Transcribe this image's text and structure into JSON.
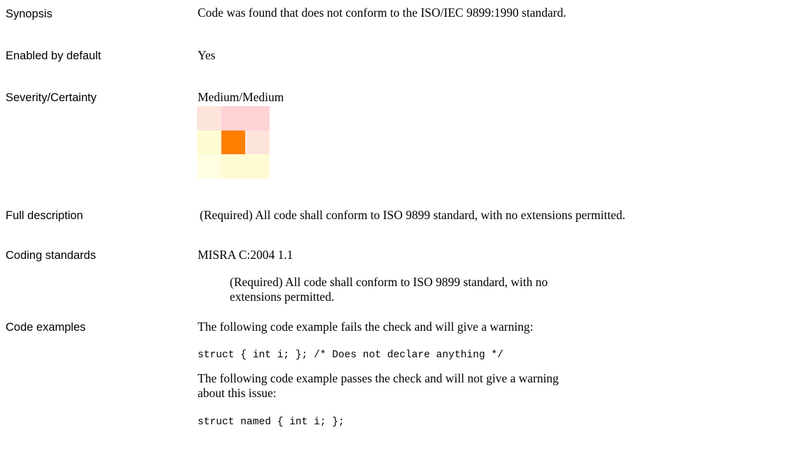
{
  "rows": {
    "synopsis": {
      "label": "Synopsis",
      "value": "Code was found that does not conform to the ISO/IEC 9899:1990 standard."
    },
    "enabled": {
      "label": "Enabled by default",
      "value": "Yes"
    },
    "severity": {
      "label": "Severity/Certainty",
      "value": "Medium/Medium",
      "matrix_colors": [
        [
          "#fde4da",
          "#fdd3d6",
          "#fdd3d6"
        ],
        [
          "#fffbd3",
          "#ff7f00",
          "#fde4da"
        ],
        [
          "#fffde2",
          "#fffbd3",
          "#fffbd3"
        ]
      ]
    },
    "full_description": {
      "label": "Full description",
      "value": "(Required) All code shall conform to ISO 9899 standard, with no extensions permitted."
    },
    "coding_standards": {
      "label": "Coding standards",
      "standard": "MISRA C:2004 1.1",
      "detail": "(Required) All code shall conform to ISO 9899 standard, with no extensions permitted."
    },
    "code_examples": {
      "label": "Code examples",
      "fail_intro": "The following code example fails the check and will give a warning:",
      "fail_code": "struct { int i; }; /* Does not declare anything */",
      "pass_intro": "The following code example passes the check and will not give a warning about this issue:",
      "pass_code": "struct named { int i; };"
    }
  }
}
